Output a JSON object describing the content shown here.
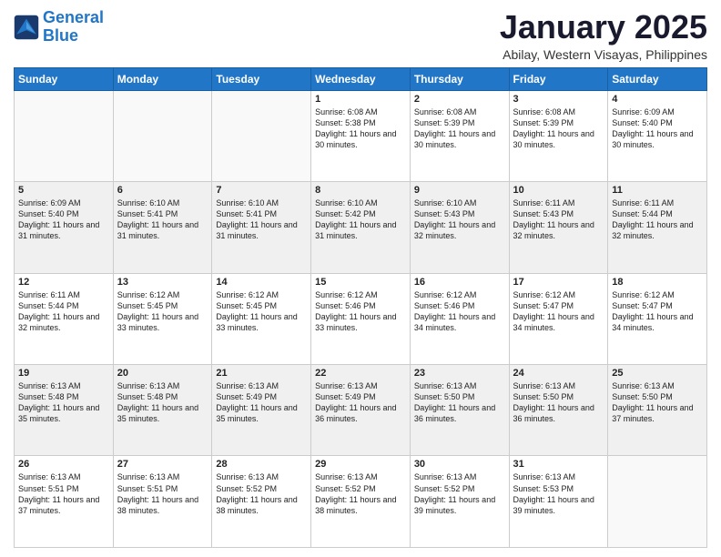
{
  "logo": {
    "line1": "General",
    "line2": "Blue"
  },
  "title": "January 2025",
  "subtitle": "Abilay, Western Visayas, Philippines",
  "days_of_week": [
    "Sunday",
    "Monday",
    "Tuesday",
    "Wednesday",
    "Thursday",
    "Friday",
    "Saturday"
  ],
  "weeks": [
    [
      {
        "num": "",
        "sunrise": "",
        "sunset": "",
        "daylight": ""
      },
      {
        "num": "",
        "sunrise": "",
        "sunset": "",
        "daylight": ""
      },
      {
        "num": "",
        "sunrise": "",
        "sunset": "",
        "daylight": ""
      },
      {
        "num": "1",
        "sunrise": "Sunrise: 6:08 AM",
        "sunset": "Sunset: 5:38 PM",
        "daylight": "Daylight: 11 hours and 30 minutes."
      },
      {
        "num": "2",
        "sunrise": "Sunrise: 6:08 AM",
        "sunset": "Sunset: 5:39 PM",
        "daylight": "Daylight: 11 hours and 30 minutes."
      },
      {
        "num": "3",
        "sunrise": "Sunrise: 6:08 AM",
        "sunset": "Sunset: 5:39 PM",
        "daylight": "Daylight: 11 hours and 30 minutes."
      },
      {
        "num": "4",
        "sunrise": "Sunrise: 6:09 AM",
        "sunset": "Sunset: 5:40 PM",
        "daylight": "Daylight: 11 hours and 30 minutes."
      }
    ],
    [
      {
        "num": "5",
        "sunrise": "Sunrise: 6:09 AM",
        "sunset": "Sunset: 5:40 PM",
        "daylight": "Daylight: 11 hours and 31 minutes."
      },
      {
        "num": "6",
        "sunrise": "Sunrise: 6:10 AM",
        "sunset": "Sunset: 5:41 PM",
        "daylight": "Daylight: 11 hours and 31 minutes."
      },
      {
        "num": "7",
        "sunrise": "Sunrise: 6:10 AM",
        "sunset": "Sunset: 5:41 PM",
        "daylight": "Daylight: 11 hours and 31 minutes."
      },
      {
        "num": "8",
        "sunrise": "Sunrise: 6:10 AM",
        "sunset": "Sunset: 5:42 PM",
        "daylight": "Daylight: 11 hours and 31 minutes."
      },
      {
        "num": "9",
        "sunrise": "Sunrise: 6:10 AM",
        "sunset": "Sunset: 5:43 PM",
        "daylight": "Daylight: 11 hours and 32 minutes."
      },
      {
        "num": "10",
        "sunrise": "Sunrise: 6:11 AM",
        "sunset": "Sunset: 5:43 PM",
        "daylight": "Daylight: 11 hours and 32 minutes."
      },
      {
        "num": "11",
        "sunrise": "Sunrise: 6:11 AM",
        "sunset": "Sunset: 5:44 PM",
        "daylight": "Daylight: 11 hours and 32 minutes."
      }
    ],
    [
      {
        "num": "12",
        "sunrise": "Sunrise: 6:11 AM",
        "sunset": "Sunset: 5:44 PM",
        "daylight": "Daylight: 11 hours and 32 minutes."
      },
      {
        "num": "13",
        "sunrise": "Sunrise: 6:12 AM",
        "sunset": "Sunset: 5:45 PM",
        "daylight": "Daylight: 11 hours and 33 minutes."
      },
      {
        "num": "14",
        "sunrise": "Sunrise: 6:12 AM",
        "sunset": "Sunset: 5:45 PM",
        "daylight": "Daylight: 11 hours and 33 minutes."
      },
      {
        "num": "15",
        "sunrise": "Sunrise: 6:12 AM",
        "sunset": "Sunset: 5:46 PM",
        "daylight": "Daylight: 11 hours and 33 minutes."
      },
      {
        "num": "16",
        "sunrise": "Sunrise: 6:12 AM",
        "sunset": "Sunset: 5:46 PM",
        "daylight": "Daylight: 11 hours and 34 minutes."
      },
      {
        "num": "17",
        "sunrise": "Sunrise: 6:12 AM",
        "sunset": "Sunset: 5:47 PM",
        "daylight": "Daylight: 11 hours and 34 minutes."
      },
      {
        "num": "18",
        "sunrise": "Sunrise: 6:12 AM",
        "sunset": "Sunset: 5:47 PM",
        "daylight": "Daylight: 11 hours and 34 minutes."
      }
    ],
    [
      {
        "num": "19",
        "sunrise": "Sunrise: 6:13 AM",
        "sunset": "Sunset: 5:48 PM",
        "daylight": "Daylight: 11 hours and 35 minutes."
      },
      {
        "num": "20",
        "sunrise": "Sunrise: 6:13 AM",
        "sunset": "Sunset: 5:48 PM",
        "daylight": "Daylight: 11 hours and 35 minutes."
      },
      {
        "num": "21",
        "sunrise": "Sunrise: 6:13 AM",
        "sunset": "Sunset: 5:49 PM",
        "daylight": "Daylight: 11 hours and 35 minutes."
      },
      {
        "num": "22",
        "sunrise": "Sunrise: 6:13 AM",
        "sunset": "Sunset: 5:49 PM",
        "daylight": "Daylight: 11 hours and 36 minutes."
      },
      {
        "num": "23",
        "sunrise": "Sunrise: 6:13 AM",
        "sunset": "Sunset: 5:50 PM",
        "daylight": "Daylight: 11 hours and 36 minutes."
      },
      {
        "num": "24",
        "sunrise": "Sunrise: 6:13 AM",
        "sunset": "Sunset: 5:50 PM",
        "daylight": "Daylight: 11 hours and 36 minutes."
      },
      {
        "num": "25",
        "sunrise": "Sunrise: 6:13 AM",
        "sunset": "Sunset: 5:50 PM",
        "daylight": "Daylight: 11 hours and 37 minutes."
      }
    ],
    [
      {
        "num": "26",
        "sunrise": "Sunrise: 6:13 AM",
        "sunset": "Sunset: 5:51 PM",
        "daylight": "Daylight: 11 hours and 37 minutes."
      },
      {
        "num": "27",
        "sunrise": "Sunrise: 6:13 AM",
        "sunset": "Sunset: 5:51 PM",
        "daylight": "Daylight: 11 hours and 38 minutes."
      },
      {
        "num": "28",
        "sunrise": "Sunrise: 6:13 AM",
        "sunset": "Sunset: 5:52 PM",
        "daylight": "Daylight: 11 hours and 38 minutes."
      },
      {
        "num": "29",
        "sunrise": "Sunrise: 6:13 AM",
        "sunset": "Sunset: 5:52 PM",
        "daylight": "Daylight: 11 hours and 38 minutes."
      },
      {
        "num": "30",
        "sunrise": "Sunrise: 6:13 AM",
        "sunset": "Sunset: 5:52 PM",
        "daylight": "Daylight: 11 hours and 39 minutes."
      },
      {
        "num": "31",
        "sunrise": "Sunrise: 6:13 AM",
        "sunset": "Sunset: 5:53 PM",
        "daylight": "Daylight: 11 hours and 39 minutes."
      },
      {
        "num": "",
        "sunrise": "",
        "sunset": "",
        "daylight": ""
      }
    ]
  ]
}
